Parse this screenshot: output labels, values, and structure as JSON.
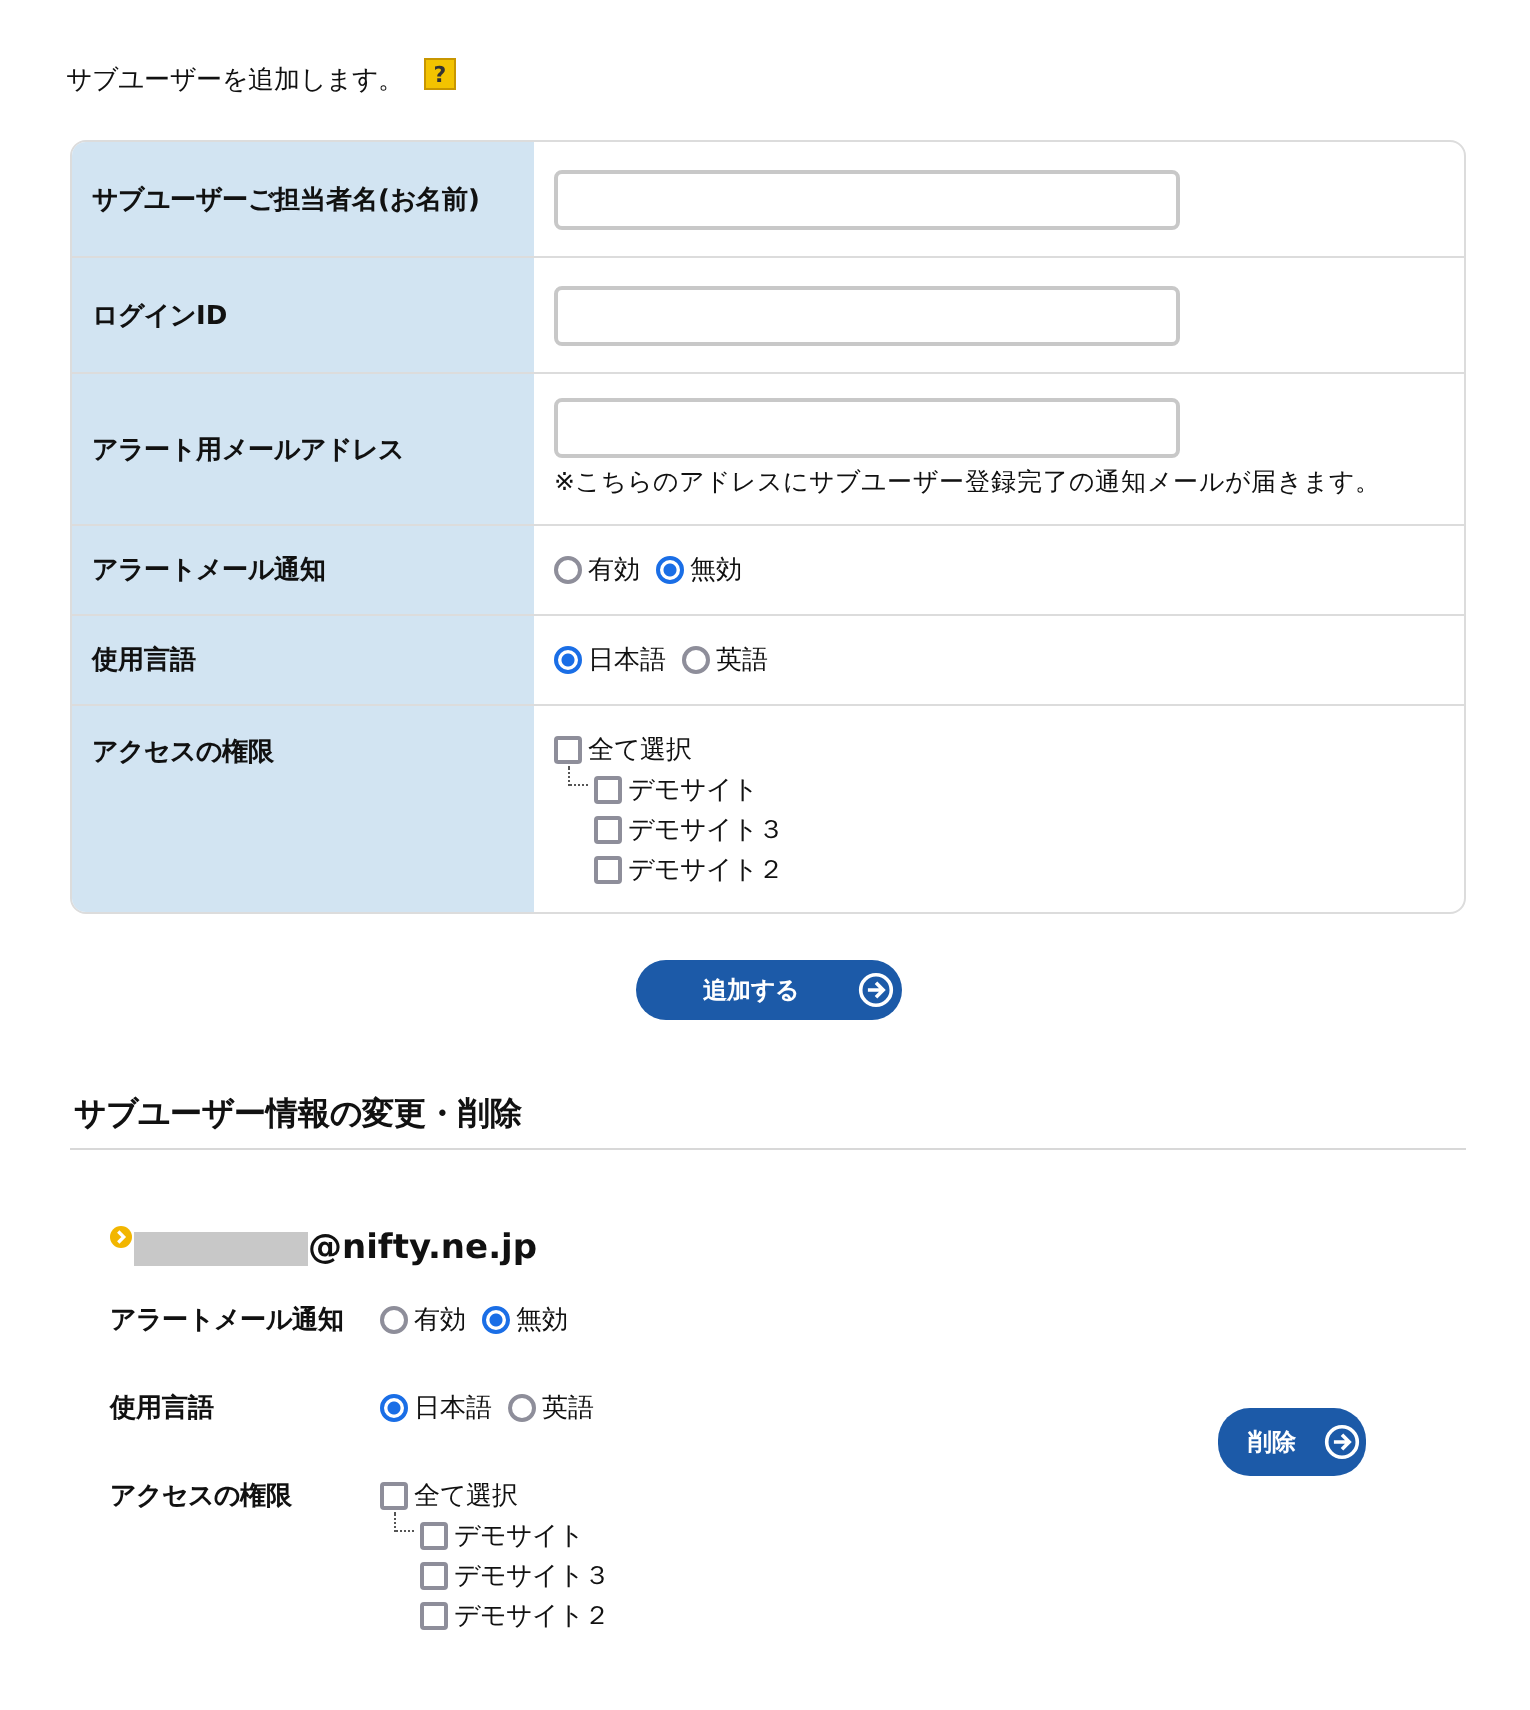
{
  "intro": {
    "text": "サブユーザーを追加します。",
    "help_badge": "?"
  },
  "form": {
    "rows": [
      {
        "kind": "text",
        "label": "サブユーザーご担当者名(お名前)"
      },
      {
        "kind": "text",
        "label": "ログインID"
      },
      {
        "kind": "text",
        "label": "アラート用メールアドレス",
        "note": "※こちらのアドレスにサブユーザー登録完了の通知メールが届きます。"
      },
      {
        "kind": "radio",
        "label": "アラートメール通知",
        "options": [
          {
            "label": "有効",
            "selected": false
          },
          {
            "label": "無効",
            "selected": true
          }
        ]
      },
      {
        "kind": "radio",
        "label": "使用言語",
        "options": [
          {
            "label": "日本語",
            "selected": true
          },
          {
            "label": "英語",
            "selected": false
          }
        ]
      },
      {
        "kind": "tree",
        "label": "アクセスの権限",
        "items": [
          {
            "label": "全て選択",
            "checked": false,
            "children": [
              {
                "label": "デモサイト",
                "checked": false
              },
              {
                "label": "デモサイト３",
                "checked": false
              },
              {
                "label": "デモサイト２",
                "checked": false
              }
            ]
          }
        ]
      }
    ]
  },
  "add_button": {
    "label": "追加する"
  },
  "edit_section": {
    "title": "サブユーザー情報の変更・削除",
    "users": [
      {
        "email_domain": "@nifty.ne.jp",
        "delete_button": {
          "label": "削除"
        },
        "rows": [
          {
            "kind": "radio",
            "label": "アラートメール通知",
            "options": [
              {
                "label": "有効",
                "selected": false
              },
              {
                "label": "無効",
                "selected": true
              }
            ]
          },
          {
            "kind": "radio",
            "label": "使用言語",
            "options": [
              {
                "label": "日本語",
                "selected": true
              },
              {
                "label": "英語",
                "selected": false
              }
            ]
          },
          {
            "kind": "tree",
            "label": "アクセスの権限",
            "items": [
              {
                "label": "全て選択",
                "checked": false,
                "children": [
                  {
                    "label": "デモサイト",
                    "checked": false
                  },
                  {
                    "label": "デモサイト３",
                    "checked": false
                  },
                  {
                    "label": "デモサイト２",
                    "checked": false
                  }
                ]
              }
            ]
          }
        ]
      }
    ]
  }
}
